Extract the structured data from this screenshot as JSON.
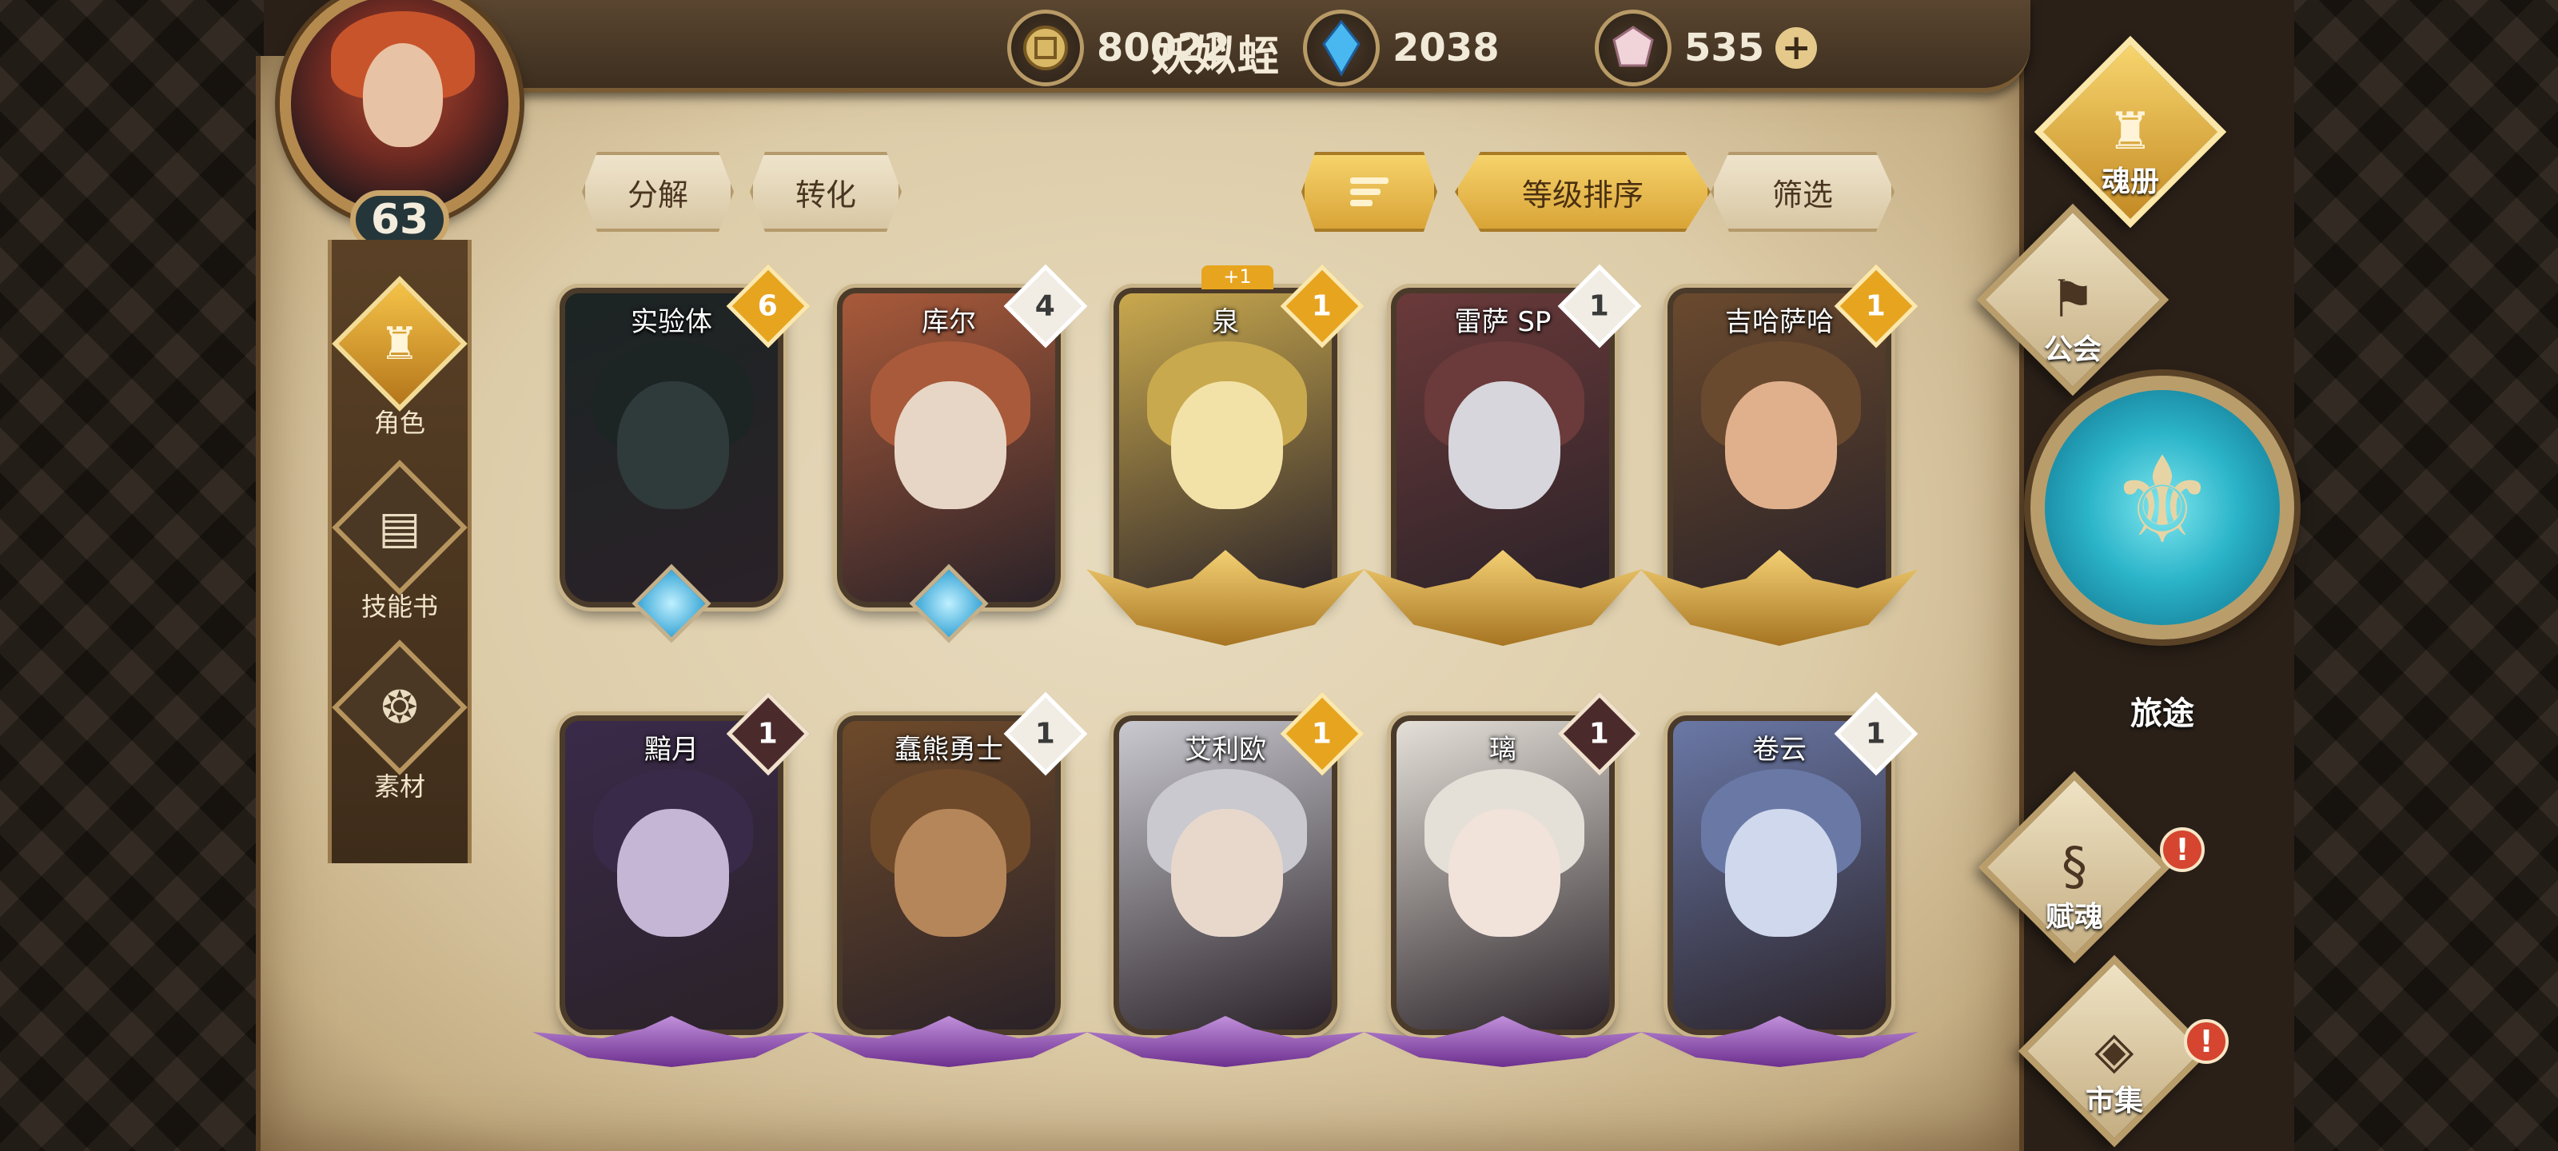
{
  "player": {
    "name": "妖姒蛭",
    "level": "63"
  },
  "currencies": [
    {
      "icon": "gold-coin-icon",
      "value": "80022"
    },
    {
      "icon": "blue-crystal-icon",
      "value": "2038"
    },
    {
      "icon": "pink-gem-icon",
      "value": "535",
      "plus": "+"
    }
  ],
  "categories": [
    {
      "label": "角色",
      "icon": "character-helmet-icon",
      "active": true
    },
    {
      "label": "技能书",
      "icon": "skill-book-icon",
      "active": false
    },
    {
      "label": "素材",
      "icon": "material-owl-icon",
      "active": false
    }
  ],
  "toolbar": {
    "decompose": "分解",
    "convert": "转化",
    "sort_by_level": "等级排序",
    "filter": "筛选"
  },
  "cards": [
    {
      "name": "实验体",
      "count": "6",
      "badge": "gold",
      "rank": "blue",
      "palette": [
        "#2f3a3a",
        "#1c2424"
      ]
    },
    {
      "name": "库尔",
      "count": "4",
      "badge": "white",
      "rank": "blue",
      "palette": [
        "#e7d6c6",
        "#a95a3a"
      ]
    },
    {
      "name": "泉",
      "count": "1",
      "badge": "gold",
      "rank": "gold",
      "extra": "+1",
      "palette": [
        "#f3e2a8",
        "#c9a94e"
      ]
    },
    {
      "name": "雷萨 SP",
      "count": "1",
      "badge": "white",
      "rank": "gold",
      "palette": [
        "#d6d6dc",
        "#6b3a3a"
      ]
    },
    {
      "name": "吉哈萨哈",
      "count": "1",
      "badge": "gold",
      "rank": "gold",
      "palette": [
        "#e0b08c",
        "#6a4a2e"
      ]
    },
    {
      "name": "黯月",
      "count": "1",
      "badge": "dark",
      "rank": "purple",
      "palette": [
        "#c6b6d6",
        "#3a2a4a"
      ]
    },
    {
      "name": "蠢熊勇士",
      "count": "1",
      "badge": "white",
      "rank": "purple",
      "palette": [
        "#b5865a",
        "#6e4a2a"
      ]
    },
    {
      "name": "艾利欧",
      "count": "1",
      "badge": "gold",
      "rank": "purple",
      "palette": [
        "#e8d8cc",
        "#c9c9cf"
      ]
    },
    {
      "name": "璃",
      "count": "1",
      "badge": "dark",
      "rank": "purple",
      "palette": [
        "#f1e2da",
        "#e4e0d8"
      ]
    },
    {
      "name": "卷云",
      "count": "1",
      "badge": "white",
      "rank": "purple",
      "palette": [
        "#cfd8ec",
        "#6a78a6"
      ]
    }
  ],
  "right_nav": {
    "soul_book": "魂册",
    "guild": "公会",
    "journey": "旅途",
    "endow_soul": "赋魂",
    "market": "市集",
    "alert_mark": "!"
  },
  "colors": {
    "gold_accent": "#e7a41f",
    "parchment": "#e2d4b4",
    "teal": "#2bb4c9"
  }
}
